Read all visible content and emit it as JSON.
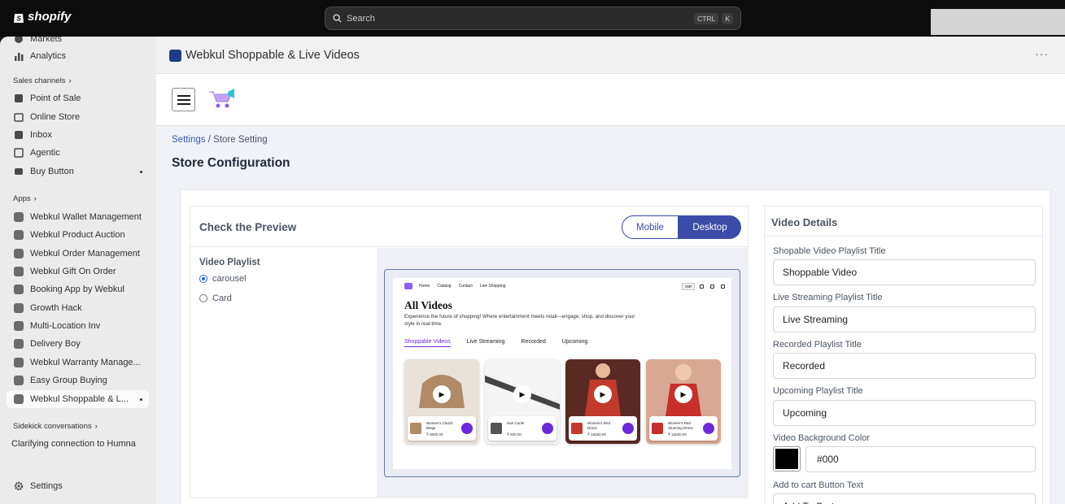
{
  "topbar": {
    "logo_text": "shopify",
    "search_placeholder": "Search",
    "shortcut_1": "CTRL",
    "shortcut_2": "K"
  },
  "sidebar": {
    "items_top": [
      {
        "label": "Markets",
        "icon": "globe-icon"
      },
      {
        "label": "Analytics",
        "icon": "bar-chart-icon"
      }
    ],
    "sales_channels_heading": "Sales channels",
    "sales_channels": [
      {
        "label": "Point of Sale",
        "icon": "pos-icon"
      },
      {
        "label": "Online Store",
        "icon": "store-icon"
      },
      {
        "label": "Inbox",
        "icon": "inbox-icon"
      },
      {
        "label": "Agentic",
        "icon": "agentic-icon"
      },
      {
        "label": "Buy Button",
        "icon": "buy-button-icon"
      }
    ],
    "apps_heading": "Apps",
    "apps": [
      {
        "label": "Webkul Wallet Management"
      },
      {
        "label": "Webkul Product Auction"
      },
      {
        "label": "Webkul Order Management"
      },
      {
        "label": "Webkul Gift On Order"
      },
      {
        "label": "Booking App by Webkul"
      },
      {
        "label": "Growth Hack"
      },
      {
        "label": "Multi-Location Inv"
      },
      {
        "label": "Delivery Boy"
      },
      {
        "label": "Webkul Warranty Manage..."
      },
      {
        "label": "Easy Group Buying"
      },
      {
        "label": "Webkul Shoppable & L..."
      }
    ],
    "sidekick_heading": "Sidekick conversations",
    "sidekick_item": "Clarifying connection to Humna",
    "settings_label": "Settings"
  },
  "app": {
    "title": "Webkul Shoppable & Live Videos",
    "more": "···"
  },
  "page": {
    "breadcrumb_root": "Settings",
    "breadcrumb_sep": " / ",
    "breadcrumb_current": "Store Setting",
    "heading": "Store Configuration"
  },
  "preview": {
    "title": "Check the Preview",
    "toggle_mobile": "Mobile",
    "toggle_desktop": "Desktop",
    "selected_view": "Desktop",
    "playlist_label": "Video Playlist",
    "options": [
      {
        "label": "carousel",
        "selected": true
      },
      {
        "label": "Card",
        "selected": false
      }
    ],
    "site": {
      "nav": [
        "Home",
        "Catalog",
        "Contact",
        "Live Shopping"
      ],
      "currency": "INR",
      "heading": "All Videos",
      "description": "Experience the future of shopping! Where entertainment meets retail—engage, shop, and discover your style in real-time.",
      "tabs": [
        "Shoppable Videos",
        "Live Streaming",
        "Recorded",
        "Upcoming"
      ],
      "active_tab": "Shoppable Videos",
      "cards": [
        {
          "product": "Women's Clutch Beige",
          "price": "₹ 8000.00",
          "bg": "#e9e2d8",
          "thumb": "#b08967"
        },
        {
          "product": "Hair Curler",
          "price": "₹ 800.00",
          "bg": "#f4f4f4",
          "thumb": "#555555"
        },
        {
          "product": "Women's Red Dress",
          "price": "₹ 15000.00",
          "bg": "#5a2a22",
          "thumb": "#c23a2b"
        },
        {
          "product": "Women's Red Stunning Dress",
          "price": "₹ 15000.00",
          "bg": "#d9a894",
          "thumb": "#c62f2a"
        }
      ]
    }
  },
  "details": {
    "title": "Video Details",
    "fields": [
      {
        "label": "Shopable Video Playlist Title",
        "value": "Shoppable Video"
      },
      {
        "label": "Live Streaming Playlist Title",
        "value": "Live Streaming"
      },
      {
        "label": "Recorded Playlist Title",
        "value": "Recorded"
      },
      {
        "label": "Upcoming Playlist Title",
        "value": "Upcoming"
      }
    ],
    "bg_color_label": "Video Background Color",
    "bg_color_value": "#000",
    "cart_text_label": "Add to cart Button Text",
    "cart_text_value": "Add To Cart"
  },
  "colors": {
    "accent": "#3b4ca8",
    "brand_purple": "#6d28d9"
  }
}
